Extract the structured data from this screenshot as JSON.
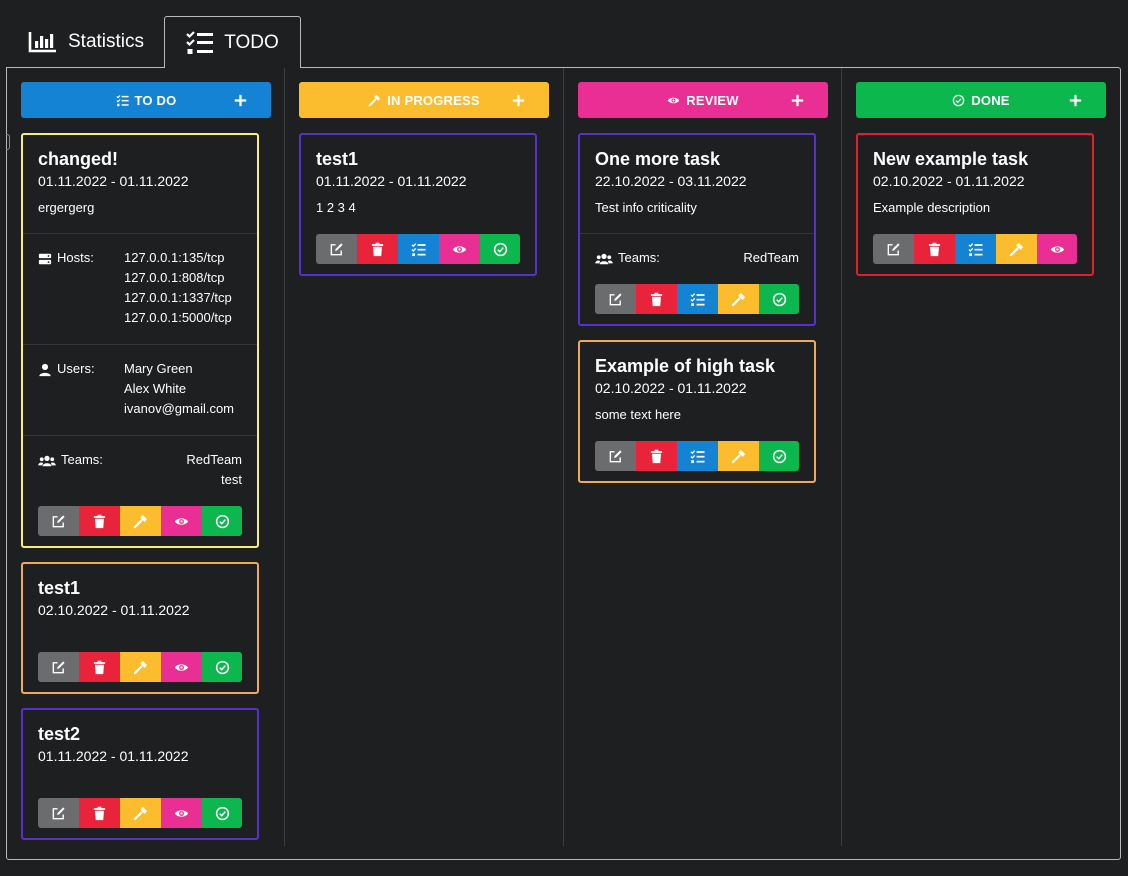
{
  "tabs": [
    {
      "label": "Statistics",
      "icon": "bar-chart-icon"
    },
    {
      "label": "TODO",
      "icon": "task-list-icon",
      "active": true
    }
  ],
  "colors": {
    "todo": "#1583d4",
    "in_progress": "#fbbc2e",
    "review": "#ea2f94",
    "done": "#0cb74e",
    "edit": "#6b6c6e",
    "delete": "#e8233a",
    "border_high": "#f6ee7a",
    "border_medium": "#f0a95c",
    "border_low": "#5a2fd0",
    "border_critical": "#e0202f"
  },
  "columns": [
    {
      "key": "todo",
      "title": "TO DO",
      "icon": "task-list-icon",
      "add_label": "+",
      "cards": [
        {
          "title": "changed!",
          "dates": "01.11.2022 - 01.11.2022",
          "desc": "ergergerg",
          "border": "border_high",
          "hosts": [
            "127.0.0.1:135/tcp",
            "127.0.0.1:808/tcp",
            "127.0.0.1:1337/tcp",
            "127.0.0.1:5000/tcp"
          ],
          "users": [
            "Mary Green",
            "Alex White",
            "ivanov@gmail.com"
          ],
          "teams": [
            "RedTeam",
            "test"
          ],
          "actions": [
            "edit",
            "delete",
            "in_progress",
            "review",
            "done"
          ]
        },
        {
          "title": "test1",
          "dates": "02.10.2022 - 01.11.2022",
          "desc": "",
          "border": "border_medium",
          "actions": [
            "edit",
            "delete",
            "in_progress",
            "review",
            "done"
          ]
        },
        {
          "title": "test2",
          "dates": "01.11.2022 - 01.11.2022",
          "desc": "",
          "border": "border_low",
          "actions": [
            "edit",
            "delete",
            "in_progress",
            "review",
            "done"
          ]
        }
      ]
    },
    {
      "key": "in_progress",
      "title": "IN PROGRESS",
      "icon": "hammer-icon",
      "add_label": "+",
      "cards": [
        {
          "title": "test1",
          "dates": "01.11.2022 - 01.11.2022",
          "desc": "1 2 3 4",
          "border": "border_low",
          "actions": [
            "edit",
            "delete",
            "todo",
            "review",
            "done"
          ]
        }
      ]
    },
    {
      "key": "review",
      "title": "REVIEW",
      "icon": "eye-icon",
      "add_label": "+",
      "cards": [
        {
          "title": "One more task",
          "dates": "22.10.2022 - 03.11.2022",
          "desc": "Test info criticality",
          "border": "border_low",
          "teams": [
            "RedTeam"
          ],
          "actions": [
            "edit",
            "delete",
            "todo",
            "in_progress",
            "done"
          ]
        },
        {
          "title": "Example of high task",
          "dates": "02.10.2022 - 01.11.2022",
          "desc": "some text here",
          "border": "border_medium",
          "actions": [
            "edit",
            "delete",
            "todo",
            "in_progress",
            "done"
          ]
        }
      ]
    },
    {
      "key": "done",
      "title": "DONE",
      "icon": "check-circle-icon",
      "add_label": "+",
      "cards": [
        {
          "title": "New example task",
          "dates": "02.10.2022 - 01.11.2022",
          "desc": "Example description",
          "border": "border_critical",
          "actions": [
            "edit",
            "delete",
            "todo",
            "in_progress",
            "review"
          ]
        }
      ]
    }
  ],
  "labels": {
    "hosts": "Hosts:",
    "users": "Users:",
    "teams": "Teams:"
  }
}
